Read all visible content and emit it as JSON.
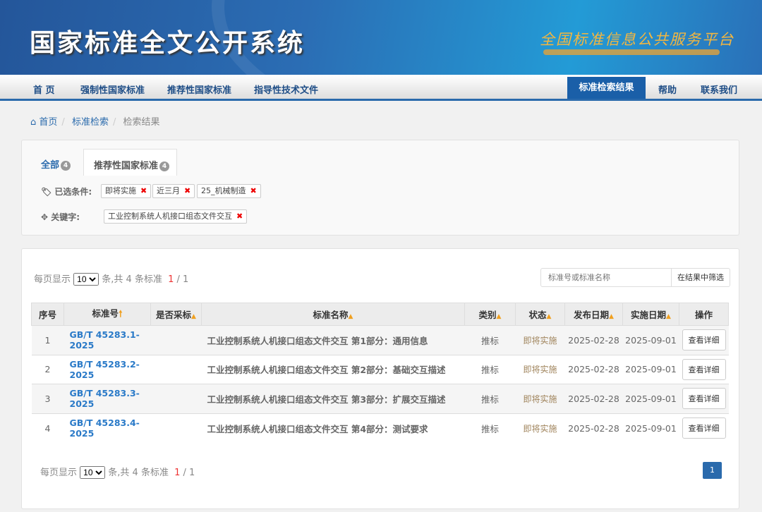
{
  "header": {
    "title": "国家标准全文公开系统",
    "slogan": "全国标准信息公共服务平台"
  },
  "nav": {
    "items": [
      "首 页",
      "强制性国家标准",
      "推荐性国家标准",
      "指导性技术文件"
    ],
    "active": "标准检索结果",
    "right": [
      "帮助",
      "联系我们"
    ]
  },
  "breadcrumb": [
    "首页",
    "标准检索",
    "检索结果"
  ],
  "filters": {
    "tabs": [
      {
        "label": "全部",
        "count": "4"
      },
      {
        "label": "推荐性国家标准",
        "count": "4"
      }
    ],
    "selected_label": "已选条件:",
    "selected": [
      "即将实施",
      "近三月",
      "25_机械制造"
    ],
    "keyword_label": "关键字:",
    "keyword": "工业控制系统人机接口组态文件交互"
  },
  "pager": {
    "per_page_label": "每页显示",
    "per_page": "10",
    "suffix": "条,共 4 条标准",
    "current": "1",
    "total": "/ 1"
  },
  "search": {
    "placeholder": "标准号或标准名称",
    "button": "在结果中筛选"
  },
  "table": {
    "headers": [
      "序号",
      "标准号",
      "是否采标",
      "标准名称",
      "类别",
      "状态",
      "发布日期",
      "实施日期",
      "操作"
    ],
    "rows": [
      {
        "no": "1",
        "code": "GB/T 45283.1-2025",
        "adopt": "",
        "name": "工业控制系统人机接口组态文件交互 第1部分：通用信息",
        "type": "推标",
        "status": "即将实施",
        "pub": "2025-02-28",
        "impl": "2025-09-01",
        "action": "查看详细"
      },
      {
        "no": "2",
        "code": "GB/T 45283.2-2025",
        "adopt": "",
        "name": "工业控制系统人机接口组态文件交互 第2部分：基础交互描述",
        "type": "推标",
        "status": "即将实施",
        "pub": "2025-02-28",
        "impl": "2025-09-01",
        "action": "查看详细"
      },
      {
        "no": "3",
        "code": "GB/T 45283.3-2025",
        "adopt": "",
        "name": "工业控制系统人机接口组态文件交互 第3部分：扩展交互描述",
        "type": "推标",
        "status": "即将实施",
        "pub": "2025-02-28",
        "impl": "2025-09-01",
        "action": "查看详细"
      },
      {
        "no": "4",
        "code": "GB/T 45283.4-2025",
        "adopt": "",
        "name": "工业控制系统人机接口组态文件交互 第4部分：测试要求",
        "type": "推标",
        "status": "即将实施",
        "pub": "2025-02-28",
        "impl": "2025-09-01",
        "action": "查看详细"
      }
    ]
  },
  "pagination": {
    "page": "1"
  }
}
